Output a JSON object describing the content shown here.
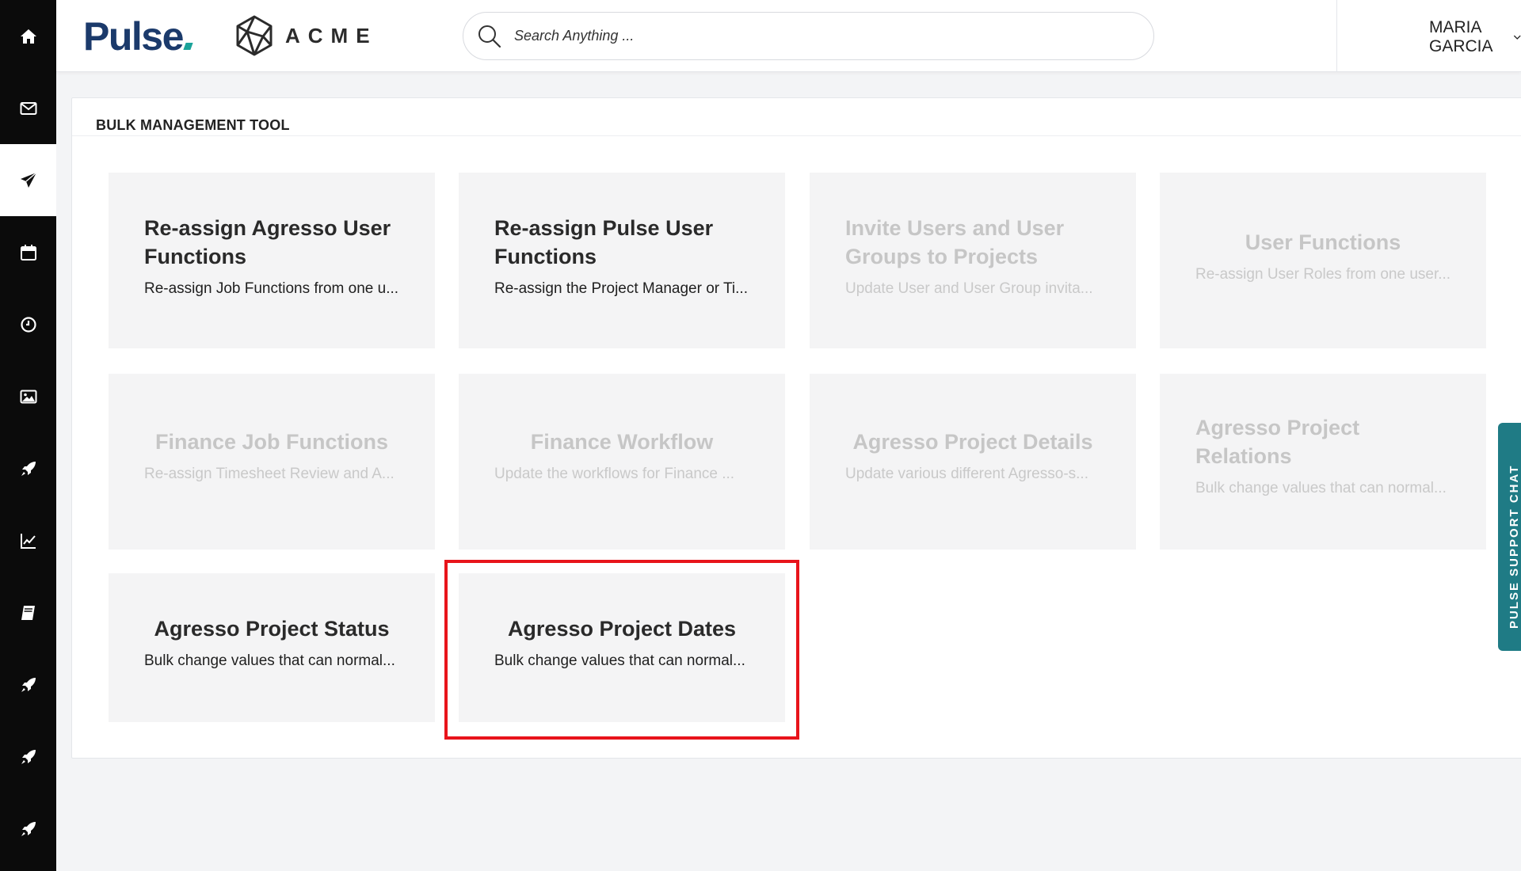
{
  "rail": {
    "items": [
      {
        "icon": "home-icon"
      },
      {
        "icon": "mail-icon"
      },
      {
        "icon": "paper-plane-icon",
        "active": true
      },
      {
        "icon": "calendar-icon"
      },
      {
        "icon": "clock-icon"
      },
      {
        "icon": "image-icon"
      },
      {
        "icon": "rocket-icon"
      },
      {
        "icon": "line-chart-icon"
      },
      {
        "icon": "book-icon"
      },
      {
        "icon": "rocket-icon"
      },
      {
        "icon": "rocket-icon"
      },
      {
        "icon": "rocket-icon"
      }
    ]
  },
  "header": {
    "brand": "Pulse",
    "client_logo": "ACME",
    "search_placeholder": "Search Anything ...",
    "user_name": "MARIA GARCIA"
  },
  "panel": {
    "title": "BULK MANAGEMENT TOOL",
    "cards": [
      {
        "title": "Re-assign Agresso User Functions",
        "description": "Re-assign Job Functions from one u...",
        "enabled": true
      },
      {
        "title": "Re-assign Pulse User Functions",
        "description": "Re-assign the Project Manager or Ti...",
        "enabled": true
      },
      {
        "title": "Invite Users and User Groups to Projects",
        "description": "Update User and User Group invita...",
        "enabled": false
      },
      {
        "title": "User Functions",
        "description": "Re-assign User Roles from one user...",
        "enabled": false
      },
      {
        "title": "Finance Job Functions",
        "description": "Re-assign Timesheet Review and A...",
        "enabled": false
      },
      {
        "title": "Finance Workflow",
        "description": "Update the workflows for Finance ...",
        "enabled": false
      },
      {
        "title": "Agresso Project Details",
        "description": "Update various different Agresso-s...",
        "enabled": false
      },
      {
        "title": "Agresso Project Relations",
        "description": "Bulk change values that can normal...",
        "enabled": false
      },
      {
        "title": "Agresso Project Status",
        "description": "Bulk change values that can normal...",
        "enabled": true
      },
      {
        "title": "Agresso Project Dates",
        "description": "Bulk change values that can normal...",
        "enabled": true,
        "highlighted": true
      }
    ]
  },
  "support_chat": {
    "label": "PULSE SUPPORT CHAT"
  },
  "colors": {
    "rail": "#0b0b0b",
    "brand_navy": "#1b3a6b",
    "brand_teal": "#1aa39a",
    "highlight": "#e8141b",
    "support_tab": "#1f7b85"
  }
}
